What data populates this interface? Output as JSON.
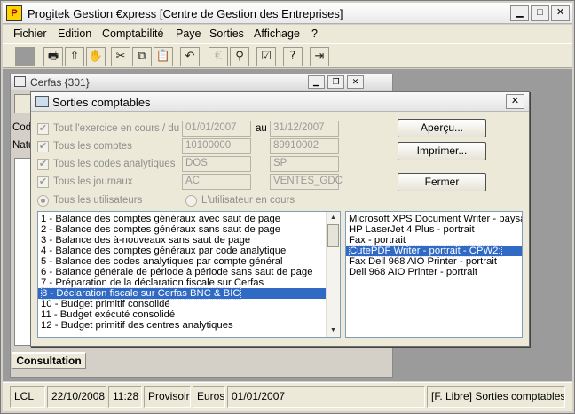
{
  "window": {
    "title": "Progitek Gestion €xpress [Centre de Gestion des Entreprises]"
  },
  "menu": [
    "Fichier",
    "Edition",
    "Comptabilité",
    "Paye",
    "Sorties",
    "Affichage",
    "?"
  ],
  "child": {
    "title": "Cerfas {301}",
    "left_label_1": "Cod",
    "left_label_2": "Natu",
    "tab": "Consultation"
  },
  "dialog": {
    "title": "Sorties comptables",
    "filters": [
      {
        "label": "Tout l'exercice en cours / du",
        "from": "01/01/2007",
        "sep": "au",
        "to": "31/12/2007"
      },
      {
        "label": "Tous les comptes",
        "from": "10100000",
        "to": "89910002"
      },
      {
        "label": "Tous les codes analytiques",
        "from": "DOS",
        "to": "SP"
      },
      {
        "label": "Tous les journaux",
        "from": "AC",
        "to": "VENTES_GDC"
      }
    ],
    "users": {
      "all": "Tous les utilisateurs",
      "current": "L'utilisateur en cours"
    },
    "buttons": {
      "preview": "Aperçu...",
      "print": "Imprimer...",
      "close": "Fermer"
    },
    "reports": [
      "1 - Balance des comptes généraux avec saut de page",
      "2 - Balance des comptes généraux sans saut de page",
      "3 - Balance des à-nouveaux sans saut de page",
      "4 - Balance des comptes généraux par code analytique",
      "5 - Balance des codes analytiques par compte général",
      "6 - Balance générale de période à période sans saut de page",
      "7 - Préparation de la déclaration fiscale sur Cerfas",
      "8 - Déclaration fiscale sur Cerfas BNC & BIC",
      "10 - Budget primitif consolidé",
      "11 - Budget exécuté consolidé",
      "12 - Budget primitif des centres analytiques"
    ],
    "selected_report": 7,
    "printers": [
      "Microsoft XPS Document Writer - paysag",
      "HP LaserJet 4 Plus - portrait",
      "Fax - portrait",
      "CutePDF Writer - portrait - CPW2:",
      "Fax Dell 968 AIO Printer - portrait",
      "Dell 968 AIO Printer - portrait"
    ],
    "selected_printer": 3
  },
  "status": {
    "user": "LCL",
    "date": "22/10/2008",
    "time": "11:28",
    "mode": "Provisoire",
    "currency": "Euros",
    "period": "01/01/2007",
    "message": "[F. Libre] Sorties comptables"
  },
  "colors": {
    "selection": "#316ac5",
    "mdi_background": "#9b9b9b"
  }
}
